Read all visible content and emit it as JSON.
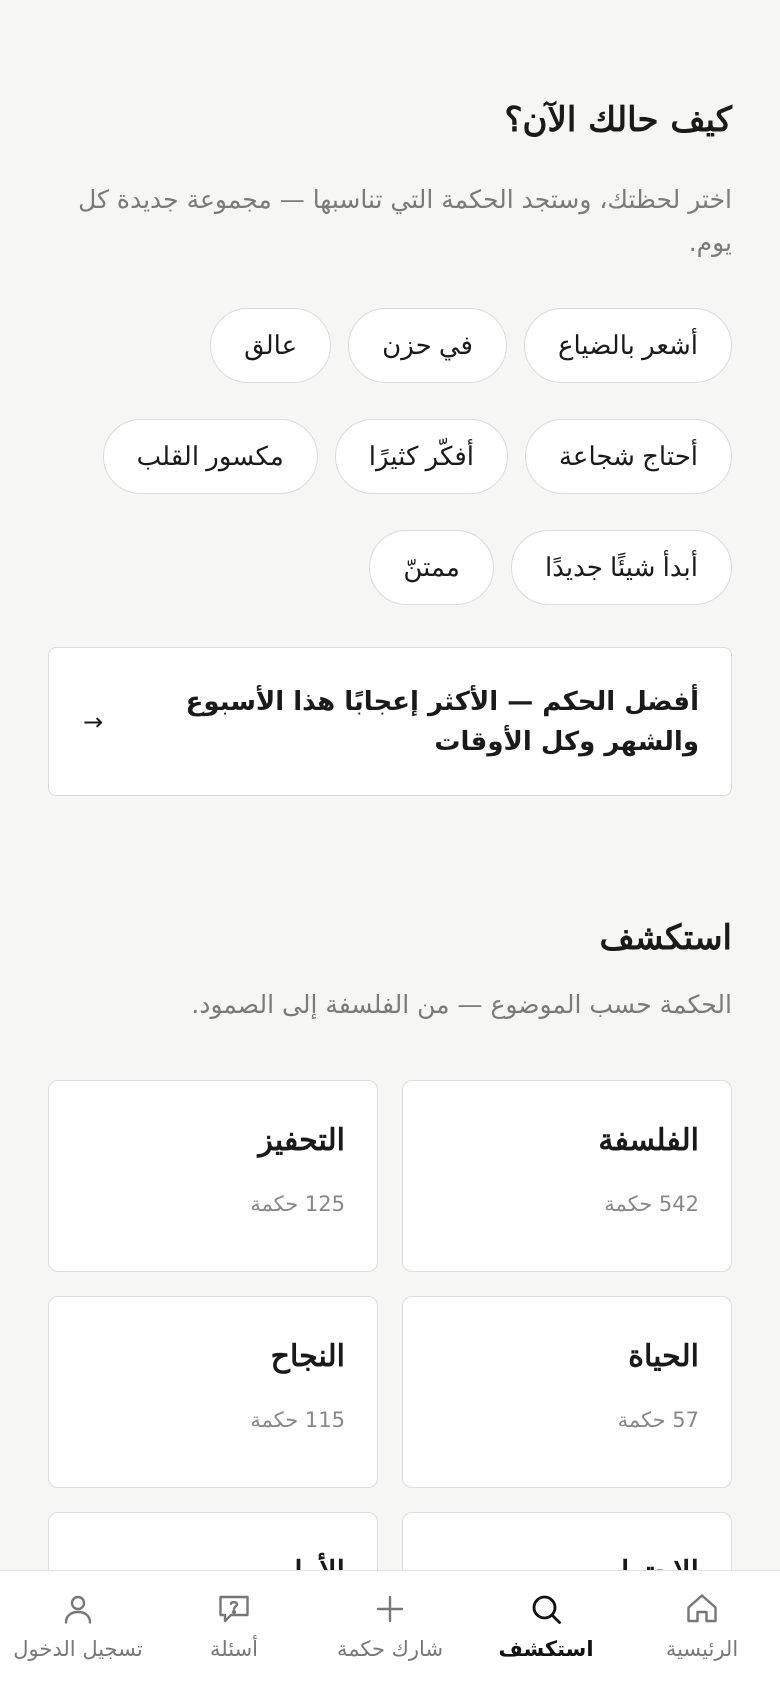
{
  "mood": {
    "title": "كيف حالك الآن؟",
    "subtitle": "اختر لحظتك، وستجد الحكمة التي تناسبها — مجموعة جديدة كل يوم.",
    "chips": [
      [
        "أشعر بالضياع",
        "في حزن",
        "عالق"
      ],
      [
        "أحتاج شجاعة",
        "أفكّر كثيرًا",
        "مكسور القلب"
      ],
      [
        "أبدأ شيئًا جديدًا",
        "ممتنّ"
      ]
    ]
  },
  "best": {
    "label": "أفضل الحكم — الأكثر إعجابًا هذا الأسبوع والشهر وكل الأوقات",
    "arrow_icon": "arrow-right-icon",
    "arrow": "→"
  },
  "explore": {
    "title": "استكشف",
    "subtitle": "الحكمة حسب الموضوع — من الفلسفة إلى الصمود.",
    "count_suffix": "حكمة",
    "topics": [
      {
        "name": "الفلسفة",
        "count": "542"
      },
      {
        "name": "التحفيز",
        "count": "125"
      },
      {
        "name": "الحياة",
        "count": "57"
      },
      {
        "name": "النجاح",
        "count": "115"
      },
      {
        "name": "الاحترام",
        "count": ""
      },
      {
        "name": "الأمل",
        "count": ""
      }
    ]
  },
  "tabs": [
    {
      "label": "الرئيسية",
      "icon": "home-icon",
      "active": false
    },
    {
      "label": "استكشف",
      "icon": "search-icon",
      "active": true
    },
    {
      "label": "شارك حكمة",
      "icon": "plus-icon",
      "active": false
    },
    {
      "label": "أسئلة",
      "icon": "question-bubble-icon",
      "active": false
    },
    {
      "label": "تسجيل الدخول",
      "icon": "user-icon",
      "active": false
    }
  ],
  "colors": {
    "background": "#f6f6f5",
    "card": "#ffffff",
    "border": "#dcdcdc",
    "muted_text": "#7a7a7a",
    "active_tab": "#111111"
  }
}
